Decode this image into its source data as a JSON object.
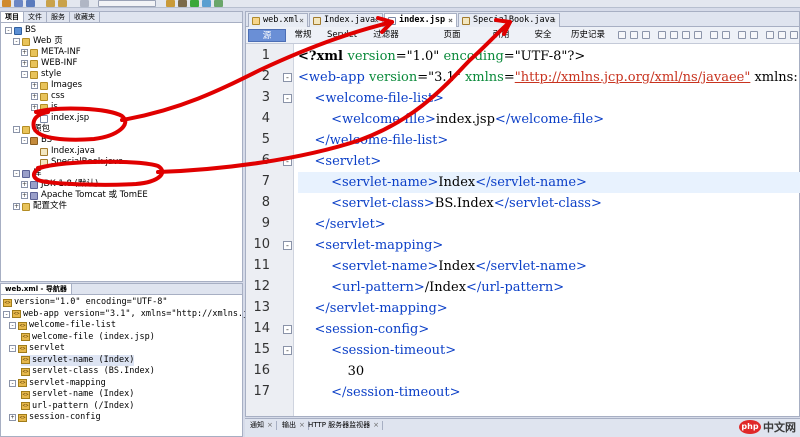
{
  "editor": {
    "tabs": [
      "web.xml",
      "Index.java",
      "index.jsp",
      "SpecialBook.java"
    ],
    "active_tab": "index.jsp",
    "subtabs": [
      "源",
      "常规",
      "Servlet",
      "过滤器",
      "页面",
      "引用",
      "安全",
      "历史记录"
    ],
    "active_subtab": "源",
    "lines": [
      {
        "n": "1",
        "fold": "",
        "segments": [
          [
            "pi",
            "<?xml "
          ],
          [
            "at",
            "version"
          ],
          [
            "tx",
            "=\"1.0\" "
          ],
          [
            "at",
            "encoding"
          ],
          [
            "tx",
            "=\"UTF-8\"?>"
          ]
        ]
      },
      {
        "n": "2",
        "fold": "-",
        "segments": [
          [
            "tg",
            "<web-app "
          ],
          [
            "at",
            "version"
          ],
          [
            "tx",
            "=\""
          ],
          [
            "tx",
            "3.1"
          ],
          [
            "tx",
            "\" "
          ],
          [
            "at",
            "xmlns"
          ],
          [
            "tx",
            "="
          ],
          [
            "av",
            "\"http://xmlns.jcp.org/xml/ns/javaee\""
          ],
          [
            "tx",
            " xmlns:"
          ]
        ]
      },
      {
        "n": "3",
        "fold": "-",
        "segments": [
          [
            "tx",
            "    "
          ],
          [
            "tg",
            "<welcome-file-list>"
          ]
        ]
      },
      {
        "n": "4",
        "fold": "",
        "segments": [
          [
            "tx",
            "        "
          ],
          [
            "tg",
            "<welcome-file>"
          ],
          [
            "tx",
            "index.jsp"
          ],
          [
            "tg",
            "</welcome-file>"
          ]
        ]
      },
      {
        "n": "5",
        "fold": "",
        "segments": [
          [
            "tx",
            "    "
          ],
          [
            "tg",
            "</welcome-file-list>"
          ]
        ]
      },
      {
        "n": "6",
        "fold": "-",
        "segments": [
          [
            "tx",
            "    "
          ],
          [
            "tg",
            "<servlet>"
          ]
        ]
      },
      {
        "n": "7",
        "fold": "",
        "segments": [
          [
            "tx",
            "        "
          ],
          [
            "tg",
            "<servlet-name>"
          ],
          [
            "tx",
            "Index"
          ],
          [
            "tg",
            "</servlet-name>"
          ]
        ]
      },
      {
        "n": "8",
        "fold": "",
        "segments": [
          [
            "tx",
            "        "
          ],
          [
            "tg",
            "<servlet-class>"
          ],
          [
            "tx",
            "BS.Index"
          ],
          [
            "tg",
            "</servlet-class>"
          ]
        ]
      },
      {
        "n": "9",
        "fold": "",
        "segments": [
          [
            "tx",
            "    "
          ],
          [
            "tg",
            "</servlet>"
          ]
        ]
      },
      {
        "n": "10",
        "fold": "-",
        "segments": [
          [
            "tx",
            "    "
          ],
          [
            "tg",
            "<servlet-mapping>"
          ]
        ]
      },
      {
        "n": "11",
        "fold": "",
        "segments": [
          [
            "tx",
            "        "
          ],
          [
            "tg",
            "<servlet-name>"
          ],
          [
            "tx",
            "Index"
          ],
          [
            "tg",
            "</servlet-name>"
          ]
        ]
      },
      {
        "n": "12",
        "fold": "",
        "segments": [
          [
            "tx",
            "        "
          ],
          [
            "tg",
            "<url-pattern>"
          ],
          [
            "tx",
            "/Index"
          ],
          [
            "tg",
            "</url-pattern>"
          ]
        ]
      },
      {
        "n": "13",
        "fold": "",
        "segments": [
          [
            "tx",
            "    "
          ],
          [
            "tg",
            "</servlet-mapping>"
          ]
        ]
      },
      {
        "n": "14",
        "fold": "-",
        "segments": [
          [
            "tx",
            "    "
          ],
          [
            "tg",
            "<session-config>"
          ]
        ]
      },
      {
        "n": "15",
        "fold": "-",
        "segments": [
          [
            "tx",
            "        "
          ],
          [
            "tg",
            "<session-timeout>"
          ]
        ]
      },
      {
        "n": "16",
        "fold": "",
        "segments": [
          [
            "tx",
            "            30"
          ]
        ]
      },
      {
        "n": "17",
        "fold": "",
        "segments": [
          [
            "tx",
            "        "
          ],
          [
            "tg",
            "</session-timeout>"
          ]
        ]
      }
    ]
  },
  "project_panel": {
    "tabs": [
      "项目",
      "文件",
      "服务",
      "收藏夹"
    ],
    "tree": [
      {
        "label": "BS",
        "icon": "project-icon",
        "exp": "-"
      },
      {
        "label": "Web 页",
        "icon": "folder-icon",
        "exp": "-"
      },
      {
        "label": "META-INF",
        "icon": "folder-icon",
        "exp": "+"
      },
      {
        "label": "WEB-INF",
        "icon": "folder-icon",
        "exp": "+"
      },
      {
        "label": "style",
        "icon": "folder-icon",
        "exp": "-"
      },
      {
        "label": "Images",
        "icon": "folder-icon",
        "exp": "+"
      },
      {
        "label": "css",
        "icon": "folder-icon",
        "exp": "+"
      },
      {
        "label": "js",
        "icon": "folder-icon",
        "exp": "+"
      },
      {
        "label": "index.jsp",
        "icon": "file-icon",
        "exp": ""
      },
      {
        "label": "源包",
        "icon": "folder-icon",
        "exp": "-"
      },
      {
        "label": "BS",
        "icon": "package-icon",
        "exp": "-"
      },
      {
        "label": "Index.java",
        "icon": "java-file-icon",
        "exp": ""
      },
      {
        "label": "SpecialBook.java",
        "icon": "java-file-icon",
        "exp": ""
      },
      {
        "label": "库",
        "icon": "library-icon",
        "exp": "-"
      },
      {
        "label": "JDK 1.8 (默认)",
        "icon": "library-icon",
        "exp": "+"
      },
      {
        "label": "Apache Tomcat 或 TomEE",
        "icon": "library-icon",
        "exp": "+"
      },
      {
        "label": "配置文件",
        "icon": "folder-icon",
        "exp": "+"
      }
    ]
  },
  "navigator": {
    "title": "web.xml - 导航器",
    "rows": [
      {
        "text": "version=\"1.0\" encoding=\"UTF-8\"",
        "exp": "",
        "selected": false
      },
      {
        "text": "web-app version=\"3.1\", xmlns=\"http://xmlns.jcp.org",
        "exp": "-",
        "selected": false
      },
      {
        "text": "welcome-file-list",
        "exp": "-",
        "selected": false
      },
      {
        "text": "welcome-file (index.jsp)",
        "exp": "",
        "selected": false
      },
      {
        "text": "servlet",
        "exp": "-",
        "selected": false
      },
      {
        "text": "servlet-name (Index)",
        "exp": "",
        "selected": true
      },
      {
        "text": "servlet-class (BS.Index)",
        "exp": "",
        "selected": false
      },
      {
        "text": "servlet-mapping",
        "exp": "-",
        "selected": false
      },
      {
        "text": "servlet-name (Index)",
        "exp": "",
        "selected": false
      },
      {
        "text": "url-pattern (/Index)",
        "exp": "",
        "selected": false
      },
      {
        "text": "session-config",
        "exp": "+",
        "selected": false
      }
    ]
  },
  "status": {
    "tabs": [
      "通知",
      "输出",
      "HTTP 服务器监视器"
    ]
  },
  "watermark": {
    "badge": "php",
    "text": "中文网"
  },
  "colors": {
    "annotation": "#e00000",
    "active_subtab": "#6a8fd6",
    "tag": "#0b3fc7",
    "attr": "#0b8a3b",
    "value": "#c8331f"
  }
}
